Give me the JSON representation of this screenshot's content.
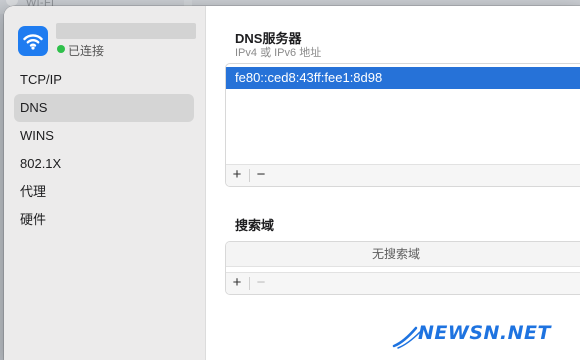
{
  "background_window": {
    "title": "Wi-Fi"
  },
  "interface": {
    "icon": "wifi-icon",
    "status_text": "已连接",
    "status_color": "#2fc04b",
    "accent": "#1f7cf0"
  },
  "sidebar": {
    "items": [
      {
        "label": "TCP/IP",
        "selected": false
      },
      {
        "label": "DNS",
        "selected": true
      },
      {
        "label": "WINS",
        "selected": false
      },
      {
        "label": "802.1X",
        "selected": false
      },
      {
        "label": "代理",
        "selected": false
      },
      {
        "label": "硬件",
        "selected": false
      }
    ]
  },
  "dns": {
    "title": "DNS服务器",
    "subtitle": "IPv4 或 IPv6 地址",
    "servers": [
      "fe80::ced8:43ff:fee1:8d98"
    ],
    "add_label": "+",
    "remove_label": "−"
  },
  "search_domains": {
    "title": "搜索域",
    "empty_text": "无搜索域",
    "add_label": "+",
    "remove_label": "−"
  },
  "watermark": {
    "text": "NEWSN.NET",
    "color": "#1e73e0"
  }
}
